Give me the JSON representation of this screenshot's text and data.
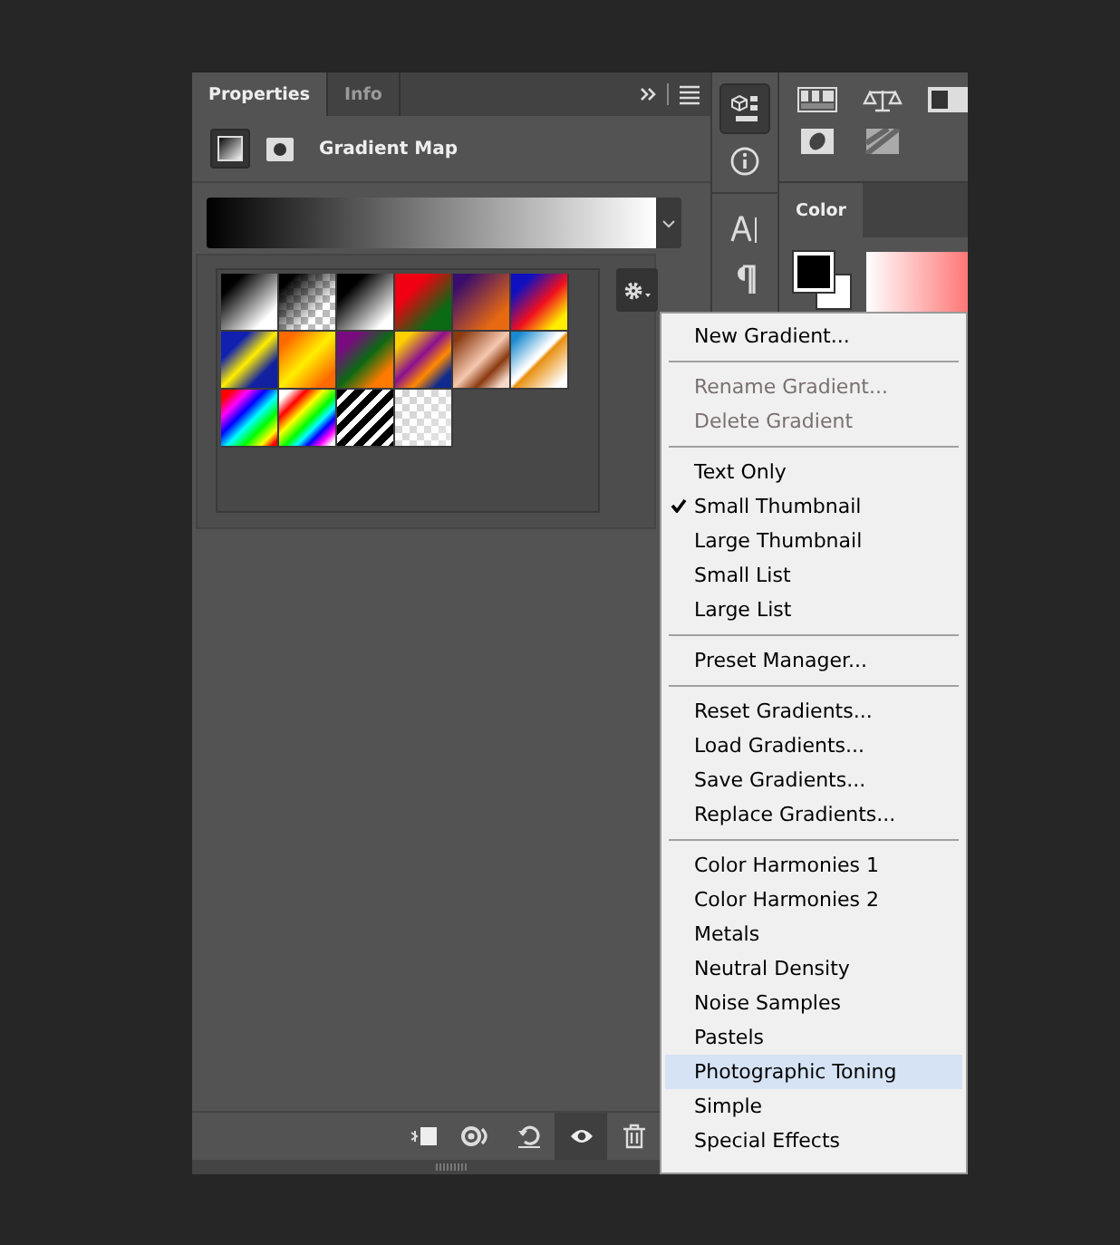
{
  "properties_panel": {
    "tabs": [
      {
        "label": "Properties",
        "selected": true
      },
      {
        "label": "Info",
        "selected": false
      }
    ],
    "title": "Gradient Map"
  },
  "color_panel": {
    "tabs": [
      {
        "label": "Color",
        "selected": true
      }
    ]
  },
  "gradient_menu": {
    "items": [
      {
        "kind": "item",
        "label": "New Gradient...",
        "disabled": false,
        "checked": false,
        "selected": false
      },
      {
        "kind": "separator"
      },
      {
        "kind": "item",
        "label": "Rename Gradient...",
        "disabled": true,
        "checked": false,
        "selected": false
      },
      {
        "kind": "item",
        "label": "Delete Gradient",
        "disabled": true,
        "checked": false,
        "selected": false
      },
      {
        "kind": "separator"
      },
      {
        "kind": "item",
        "label": "Text Only",
        "disabled": false,
        "checked": false,
        "selected": false
      },
      {
        "kind": "item",
        "label": "Small Thumbnail",
        "disabled": false,
        "checked": true,
        "selected": false
      },
      {
        "kind": "item",
        "label": "Large Thumbnail",
        "disabled": false,
        "checked": false,
        "selected": false
      },
      {
        "kind": "item",
        "label": "Small List",
        "disabled": false,
        "checked": false,
        "selected": false
      },
      {
        "kind": "item",
        "label": "Large List",
        "disabled": false,
        "checked": false,
        "selected": false
      },
      {
        "kind": "separator"
      },
      {
        "kind": "item",
        "label": "Preset Manager...",
        "disabled": false,
        "checked": false,
        "selected": false
      },
      {
        "kind": "separator"
      },
      {
        "kind": "item",
        "label": "Reset Gradients...",
        "disabled": false,
        "checked": false,
        "selected": false
      },
      {
        "kind": "item",
        "label": "Load Gradients...",
        "disabled": false,
        "checked": false,
        "selected": false
      },
      {
        "kind": "item",
        "label": "Save Gradients...",
        "disabled": false,
        "checked": false,
        "selected": false
      },
      {
        "kind": "item",
        "label": "Replace Gradients...",
        "disabled": false,
        "checked": false,
        "selected": false
      },
      {
        "kind": "separator"
      },
      {
        "kind": "item",
        "label": "Color Harmonies 1",
        "disabled": false,
        "checked": false,
        "selected": false
      },
      {
        "kind": "item",
        "label": "Color Harmonies 2",
        "disabled": false,
        "checked": false,
        "selected": false
      },
      {
        "kind": "item",
        "label": "Metals",
        "disabled": false,
        "checked": false,
        "selected": false
      },
      {
        "kind": "item",
        "label": "Neutral Density",
        "disabled": false,
        "checked": false,
        "selected": false
      },
      {
        "kind": "item",
        "label": "Noise Samples",
        "disabled": false,
        "checked": false,
        "selected": false
      },
      {
        "kind": "item",
        "label": "Pastels",
        "disabled": false,
        "checked": false,
        "selected": false
      },
      {
        "kind": "item",
        "label": "Photographic Toning",
        "disabled": false,
        "checked": false,
        "selected": true
      },
      {
        "kind": "item",
        "label": "Simple",
        "disabled": false,
        "checked": false,
        "selected": false
      },
      {
        "kind": "item",
        "label": "Special Effects",
        "disabled": false,
        "checked": false,
        "selected": false
      }
    ]
  }
}
